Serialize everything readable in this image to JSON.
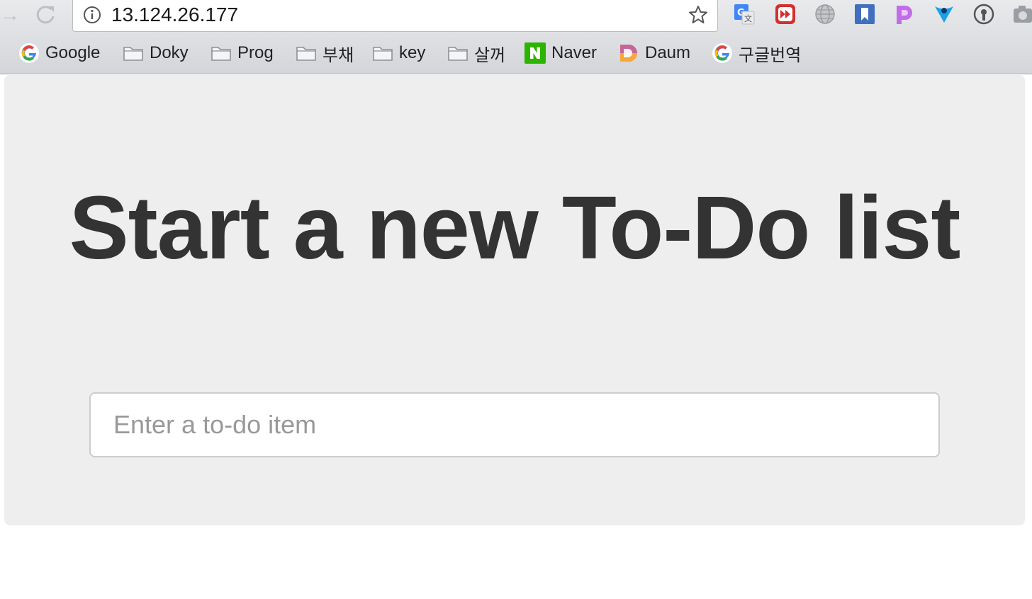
{
  "browser": {
    "url": "13.124.26.177",
    "extensions": [
      "google-translate-icon",
      "fast-forward-icon",
      "globe-icon",
      "bookmark-icon",
      "pocket-icon",
      "vpn-icon",
      "password-manager-icon",
      "camera-icon"
    ]
  },
  "bookmarks": [
    {
      "label": "Google",
      "icon": "google-icon"
    },
    {
      "label": "Doky",
      "icon": "folder-icon"
    },
    {
      "label": "Prog",
      "icon": "folder-icon"
    },
    {
      "label": "부채",
      "icon": "folder-icon"
    },
    {
      "label": "key",
      "icon": "folder-icon"
    },
    {
      "label": "살꺼",
      "icon": "folder-icon"
    },
    {
      "label": "Naver",
      "icon": "naver-icon"
    },
    {
      "label": "Daum",
      "icon": "daum-icon"
    },
    {
      "label": "구글번역",
      "icon": "google-icon"
    }
  ],
  "page": {
    "heading": "Start a new To-Do list",
    "input_placeholder": "Enter a to-do item",
    "input_value": ""
  },
  "colors": {
    "jumbotron_bg": "#eeeeee",
    "heading_text": "#333333",
    "naver_green": "#2db400"
  }
}
